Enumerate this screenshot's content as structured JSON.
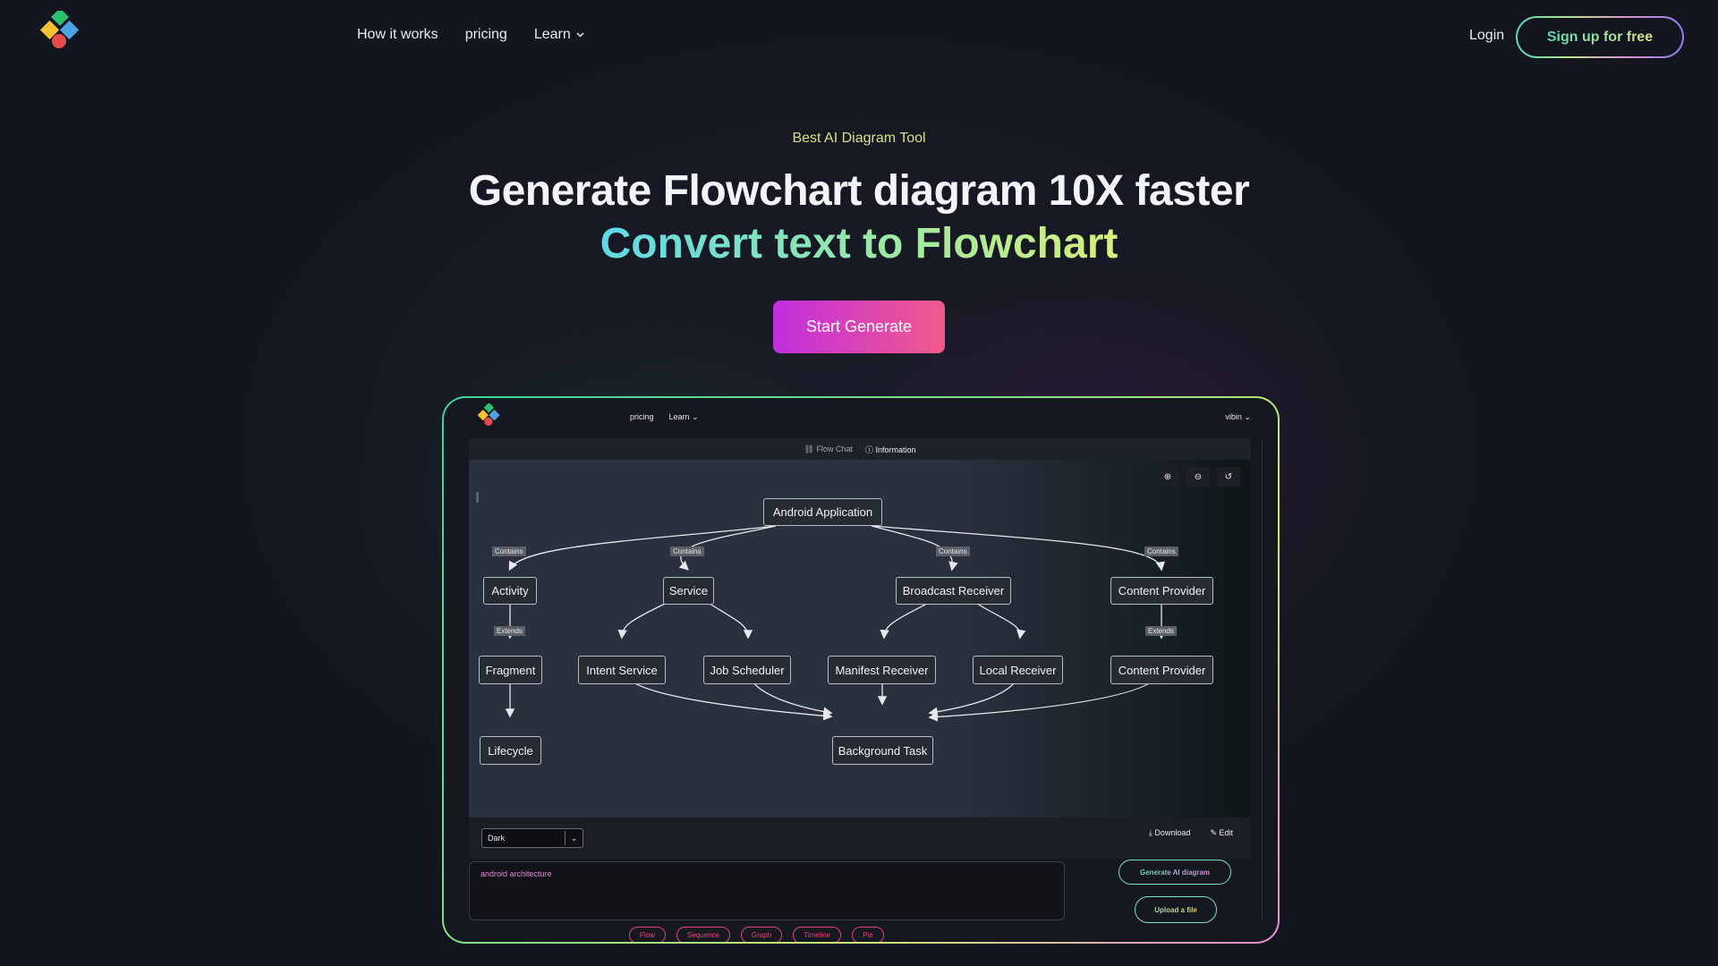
{
  "nav": {
    "links": [
      "How it works",
      "pricing",
      "Learn"
    ],
    "login": "Login",
    "signup": "Sign up for free"
  },
  "hero": {
    "eyebrow": "Best AI Diagram Tool",
    "headline": "Generate Flowchart diagram 10X faster",
    "subline": "Convert text to Flowchart",
    "cta": "Start Generate"
  },
  "preview": {
    "nav_pricing": "pricing",
    "nav_learn": "Learn",
    "user": "vibin",
    "tab_flow": "Flow Chat",
    "tab_info": "Information",
    "theme": "Dark",
    "download": "Download",
    "edit": "Edit",
    "prompt": "android architecture",
    "generate": "Generate AI diagram",
    "upload": "Upload a file",
    "chips": [
      "Flow",
      "Sequence",
      "Graph",
      "Timeline",
      "Pie"
    ]
  },
  "diagram": {
    "root": "Android Application",
    "nodes": {
      "activity": "Activity",
      "service": "Service",
      "broadcast": "Broadcast Receiver",
      "content1": "Content Provider",
      "fragment": "Fragment",
      "intent": "Intent Service",
      "job": "Job Scheduler",
      "manifest": "Manifest Receiver",
      "local": "Local Receiver",
      "content2": "Content Provider",
      "lifecycle": "Lifecycle",
      "background": "Background Task"
    },
    "edge_labels": {
      "contains": "Contains",
      "extends": "Extends"
    }
  },
  "colors": {
    "background": "#14161f",
    "accent_green": "#62d8b4",
    "accent_pink": "#e0457a",
    "cta_start": "#c02ee0",
    "cta_end": "#f25a8a"
  }
}
